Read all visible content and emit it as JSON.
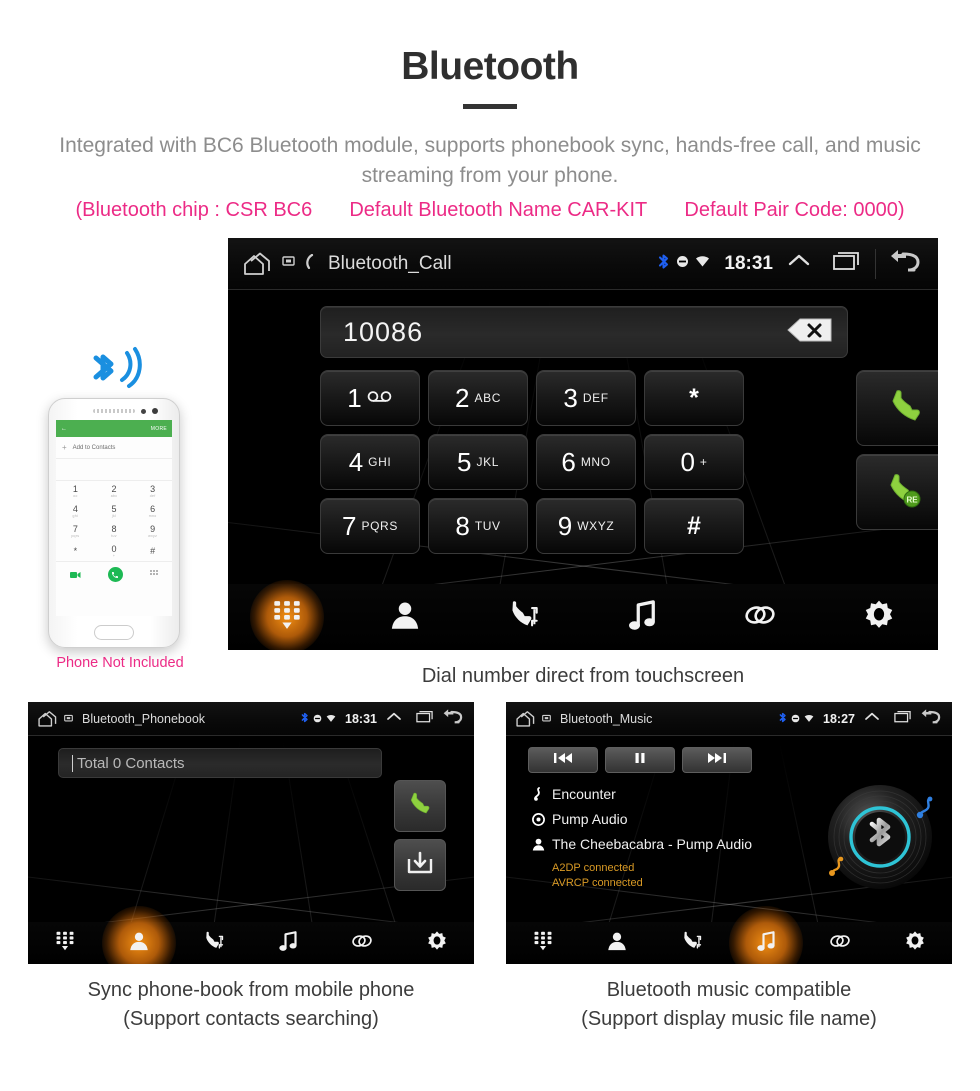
{
  "header": {
    "title": "Bluetooth",
    "subtitle": "Integrated with BC6 Bluetooth module, supports phonebook sync, hands-free call, and music streaming from your phone.",
    "spec_chip": "(Bluetooth chip : CSR BC6",
    "spec_name": "Default Bluetooth Name CAR-KIT",
    "spec_pair": "Default Pair Code: 0000)",
    "accent_pink": "#ec2b86",
    "subtitle_color": "#8d8d8d"
  },
  "phone_mockup": {
    "app_back": "←",
    "more_label": "MORE",
    "add_contacts": "Add to Contacts",
    "plus": "+",
    "keys": [
      {
        "digit": "1",
        "letters": "oo"
      },
      {
        "digit": "2",
        "letters": "abc"
      },
      {
        "digit": "3",
        "letters": "def"
      },
      {
        "digit": "4",
        "letters": "ghi"
      },
      {
        "digit": "5",
        "letters": "jkl"
      },
      {
        "digit": "6",
        "letters": "mno"
      },
      {
        "digit": "7",
        "letters": "pqrs"
      },
      {
        "digit": "8",
        "letters": "tuv"
      },
      {
        "digit": "9",
        "letters": "wxyz"
      },
      {
        "digit": "*",
        "letters": ""
      },
      {
        "digit": "0",
        "letters": "+"
      },
      {
        "digit": "#",
        "letters": ""
      }
    ],
    "caption": "Phone Not Included",
    "bluetooth_color": "#1a8fe0",
    "app_accent": "#4caf50"
  },
  "dialer": {
    "statusbar": {
      "title": "Bluetooth_Call",
      "time": "18:31",
      "icons": [
        "home-icon",
        "screen-icon",
        "phone-small-icon"
      ],
      "status_icons": [
        "bluetooth-icon",
        "dnd-icon",
        "wifi-icon"
      ],
      "nav_icons": [
        "chevron-up-icon",
        "recents-icon",
        "back-icon"
      ]
    },
    "number": "10086",
    "backspace_label": "×",
    "keys": [
      [
        {
          "digit": "1",
          "letters": "",
          "voicemail": true
        },
        {
          "digit": "2",
          "letters": "ABC"
        },
        {
          "digit": "3",
          "letters": "DEF"
        },
        {
          "digit": "*",
          "letters": "",
          "symbol": true
        }
      ],
      [
        {
          "digit": "4",
          "letters": "GHI"
        },
        {
          "digit": "5",
          "letters": "JKL"
        },
        {
          "digit": "6",
          "letters": "MNO"
        },
        {
          "digit": "0",
          "letters": "+"
        }
      ],
      [
        {
          "digit": "7",
          "letters": "PQRS"
        },
        {
          "digit": "8",
          "letters": "TUV"
        },
        {
          "digit": "9",
          "letters": "WXYZ"
        },
        {
          "digit": "#",
          "letters": "",
          "symbol": true
        }
      ]
    ],
    "call_button": "call-icon",
    "redial_button": "redial-icon",
    "redial_badge": "RE",
    "nav": [
      {
        "name": "keypad",
        "icon": "keypad-icon",
        "active": true
      },
      {
        "name": "contacts",
        "icon": "contact-icon",
        "active": false
      },
      {
        "name": "call-log",
        "icon": "call-log-icon",
        "active": false
      },
      {
        "name": "music",
        "icon": "music-note-icon",
        "active": false
      },
      {
        "name": "pair",
        "icon": "link-icon",
        "active": false
      },
      {
        "name": "settings",
        "icon": "gear-icon",
        "active": false
      }
    ],
    "caption": "Dial number direct from touchscreen"
  },
  "phonebook": {
    "statusbar": {
      "title": "Bluetooth_Phonebook",
      "time": "18:31"
    },
    "search_value": "Total 0 Contacts",
    "side_buttons": [
      {
        "name": "call",
        "icon": "call-icon"
      },
      {
        "name": "download-contacts",
        "icon": "download-icon"
      }
    ],
    "nav": [
      {
        "name": "keypad",
        "icon": "keypad-icon",
        "active": false
      },
      {
        "name": "contacts",
        "icon": "contact-icon",
        "active": true
      },
      {
        "name": "call-log",
        "icon": "call-log-icon",
        "active": false
      },
      {
        "name": "music",
        "icon": "music-note-icon",
        "active": false
      },
      {
        "name": "pair",
        "icon": "link-icon",
        "active": false
      },
      {
        "name": "settings",
        "icon": "gear-icon",
        "active": false
      }
    ],
    "caption_line1": "Sync phone-book from mobile phone",
    "caption_line2": "(Support contacts searching)"
  },
  "music": {
    "statusbar": {
      "title": "Bluetooth_Music",
      "time": "18:27"
    },
    "transport": [
      {
        "name": "previous",
        "icon": "prev-icon"
      },
      {
        "name": "pause",
        "icon": "pause-icon"
      },
      {
        "name": "next",
        "icon": "next-icon"
      }
    ],
    "track": "Encounter",
    "album": "Pump Audio",
    "artist": "The Cheebacabra - Pump Audio",
    "status_a2dp": "A2DP connected",
    "status_avrcp": "AVRCP connected",
    "status_color": "#d99a25",
    "disc_ring_color": "#2ec4d6",
    "nav": [
      {
        "name": "keypad",
        "icon": "keypad-icon",
        "active": false
      },
      {
        "name": "contacts",
        "icon": "contact-icon",
        "active": false
      },
      {
        "name": "call-log",
        "icon": "call-log-icon",
        "active": false
      },
      {
        "name": "music",
        "icon": "music-note-icon",
        "active": true
      },
      {
        "name": "pair",
        "icon": "link-icon",
        "active": false
      },
      {
        "name": "settings",
        "icon": "gear-icon",
        "active": false
      }
    ],
    "caption_line1": "Bluetooth music compatible",
    "caption_line2": "(Support display music file name)"
  }
}
